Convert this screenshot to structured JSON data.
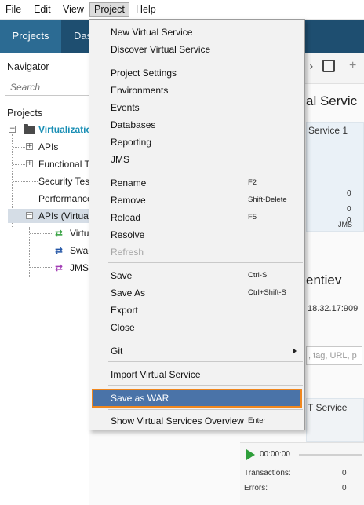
{
  "menubar": {
    "items": [
      {
        "label": "File"
      },
      {
        "label": "Edit"
      },
      {
        "label": "View"
      },
      {
        "label": "Project"
      },
      {
        "label": "Help"
      }
    ]
  },
  "tabs": {
    "projects": "Projects",
    "dashboard_partial": "Das"
  },
  "navigator": {
    "title": "Navigator",
    "search_placeholder": "Search",
    "projects_label": "Projects",
    "tree": {
      "project": "Virtualization",
      "apis": "APIs",
      "functional": "Functional T",
      "security": "Security Tes",
      "performance": "Performance",
      "apis_virtual": "APIs (Virtua",
      "child_virtual": "Virtu",
      "child_swagger": "Swag",
      "child_jms": "JMS"
    }
  },
  "main": {
    "heading_partial": "al Servic",
    "service_partial": "Service 1",
    "axis_zero_1": "0",
    "axis_zero_2": "0",
    "axis_zero_3": "0",
    "axis_jms": "JMS",
    "user_partial": "entiev",
    "address_partial": "18.32.17:909",
    "search_hint": ", tag, URL, p",
    "service_partial_2": "T Service",
    "timer": "00:00:00",
    "transactions_label": "Transactions:",
    "transactions_value": "0",
    "errors_label": "Errors:",
    "errors_value": "0"
  },
  "menu": {
    "new_virtual_service": "New Virtual Service",
    "discover_virtual_service": "Discover Virtual Service",
    "project_settings": "Project Settings",
    "environments": "Environments",
    "events": "Events",
    "databases": "Databases",
    "reporting": "Reporting",
    "jms": "JMS",
    "rename": "Rename",
    "rename_shortcut": "F2",
    "remove": "Remove",
    "remove_shortcut": "Shift-Delete",
    "reload": "Reload",
    "reload_shortcut": "F5",
    "resolve": "Resolve",
    "refresh": "Refresh",
    "save": "Save",
    "save_shortcut": "Ctrl-S",
    "save_as": "Save As",
    "save_as_shortcut": "Ctrl+Shift-S",
    "export": "Export",
    "close": "Close",
    "git": "Git",
    "import_virtual_service": "Import Virtual Service",
    "save_as_war": "Save as WAR",
    "show_overview": "Show Virtual Services Overview",
    "show_overview_shortcut": "Enter"
  },
  "colors": {
    "accent": "#4a73a8",
    "highlight_border": "#f0871e",
    "tabs_bar": "#1e4e70",
    "tab_active": "#2c6b93",
    "project_text": "#1a8fb5",
    "icon_green": "#2e9e3a",
    "icon_blue": "#2355a6",
    "icon_purple": "#a23db5"
  }
}
